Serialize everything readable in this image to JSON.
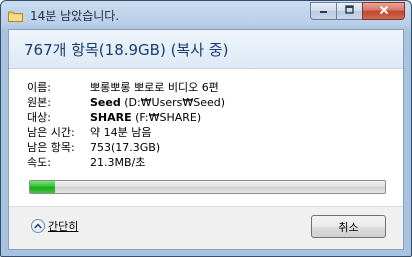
{
  "window": {
    "title": "14분 남았습니다.",
    "icons": [
      "folder-icon",
      "minimize-icon",
      "maximize-icon",
      "close-icon"
    ]
  },
  "summary": "767개 항목(18.9GB) (복사 중)",
  "details": {
    "name_label": "이름:",
    "name_value": "뽀롱뽀롱 뽀로로 비디오 6편",
    "source_label": "원본:",
    "source_bold": "Seed",
    "source_path": " (D:₩Users₩Seed)",
    "dest_label": "대상:",
    "dest_bold": "SHARE",
    "dest_path": " (F:₩SHARE)",
    "time_label": "남은 시간:",
    "time_value": "약 14분 남음",
    "items_label": "남은 항목:",
    "items_value": "753(17.3GB)",
    "speed_label": "속도:",
    "speed_value": "21.3MB/초"
  },
  "progress": {
    "percent": 7,
    "color": "#2fc02f"
  },
  "footer": {
    "toggle_label": "간단히",
    "cancel_label": "취소"
  }
}
